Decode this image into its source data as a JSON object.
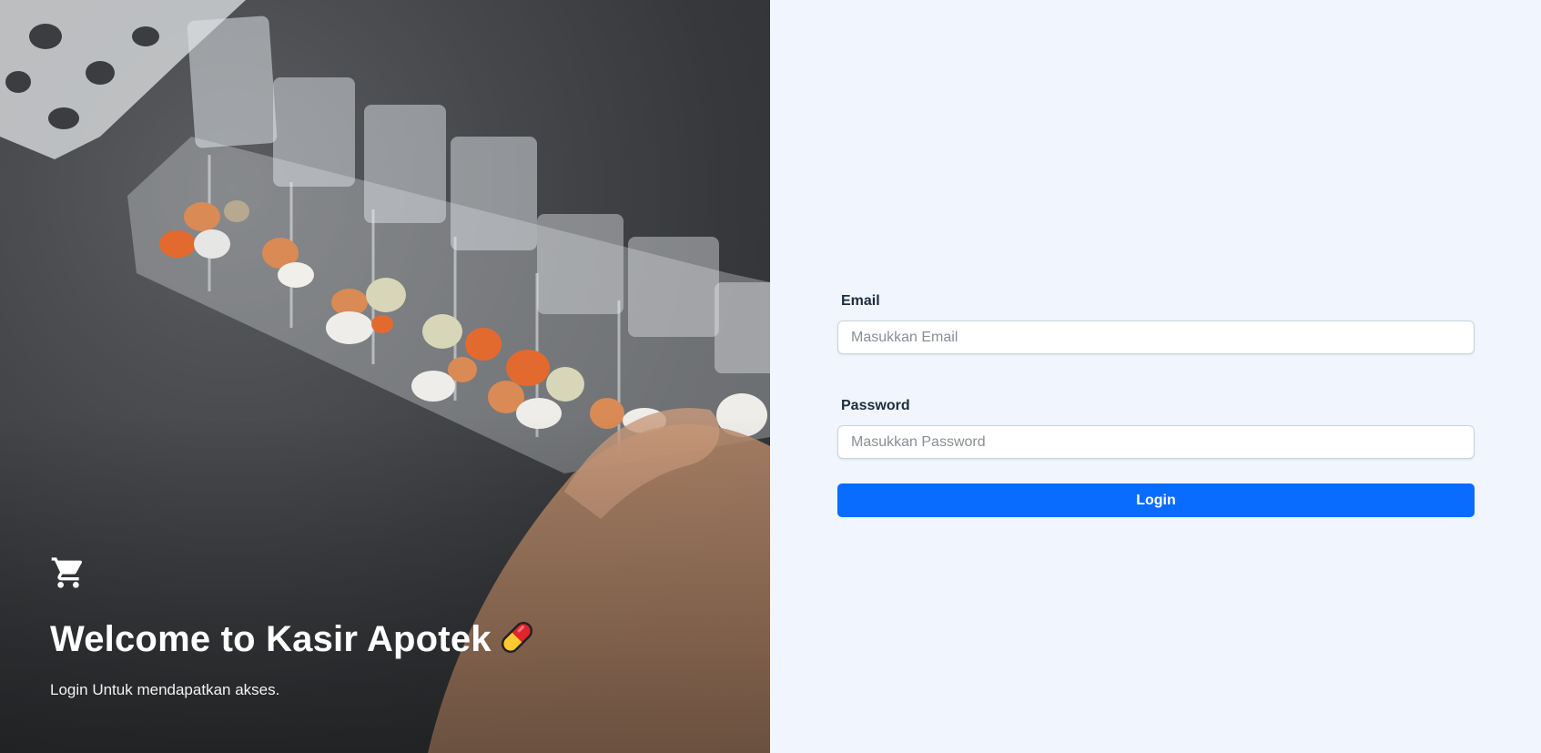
{
  "hero": {
    "title": "Welcome to Kasir Apotek",
    "title_emoji_icon": "pill-icon",
    "subtitle": "Login Untuk mendapatkan akses.",
    "brand_icon": "shopping-cart-icon"
  },
  "form": {
    "email": {
      "label": "Email",
      "placeholder": "Masukkan Email",
      "value": ""
    },
    "password": {
      "label": "Password",
      "placeholder": "Masukkan Password",
      "value": ""
    },
    "submit_label": "Login"
  },
  "colors": {
    "page_bg": "#f0f5fe",
    "primary": "#0a6cff",
    "label": "#1f2d3d"
  }
}
